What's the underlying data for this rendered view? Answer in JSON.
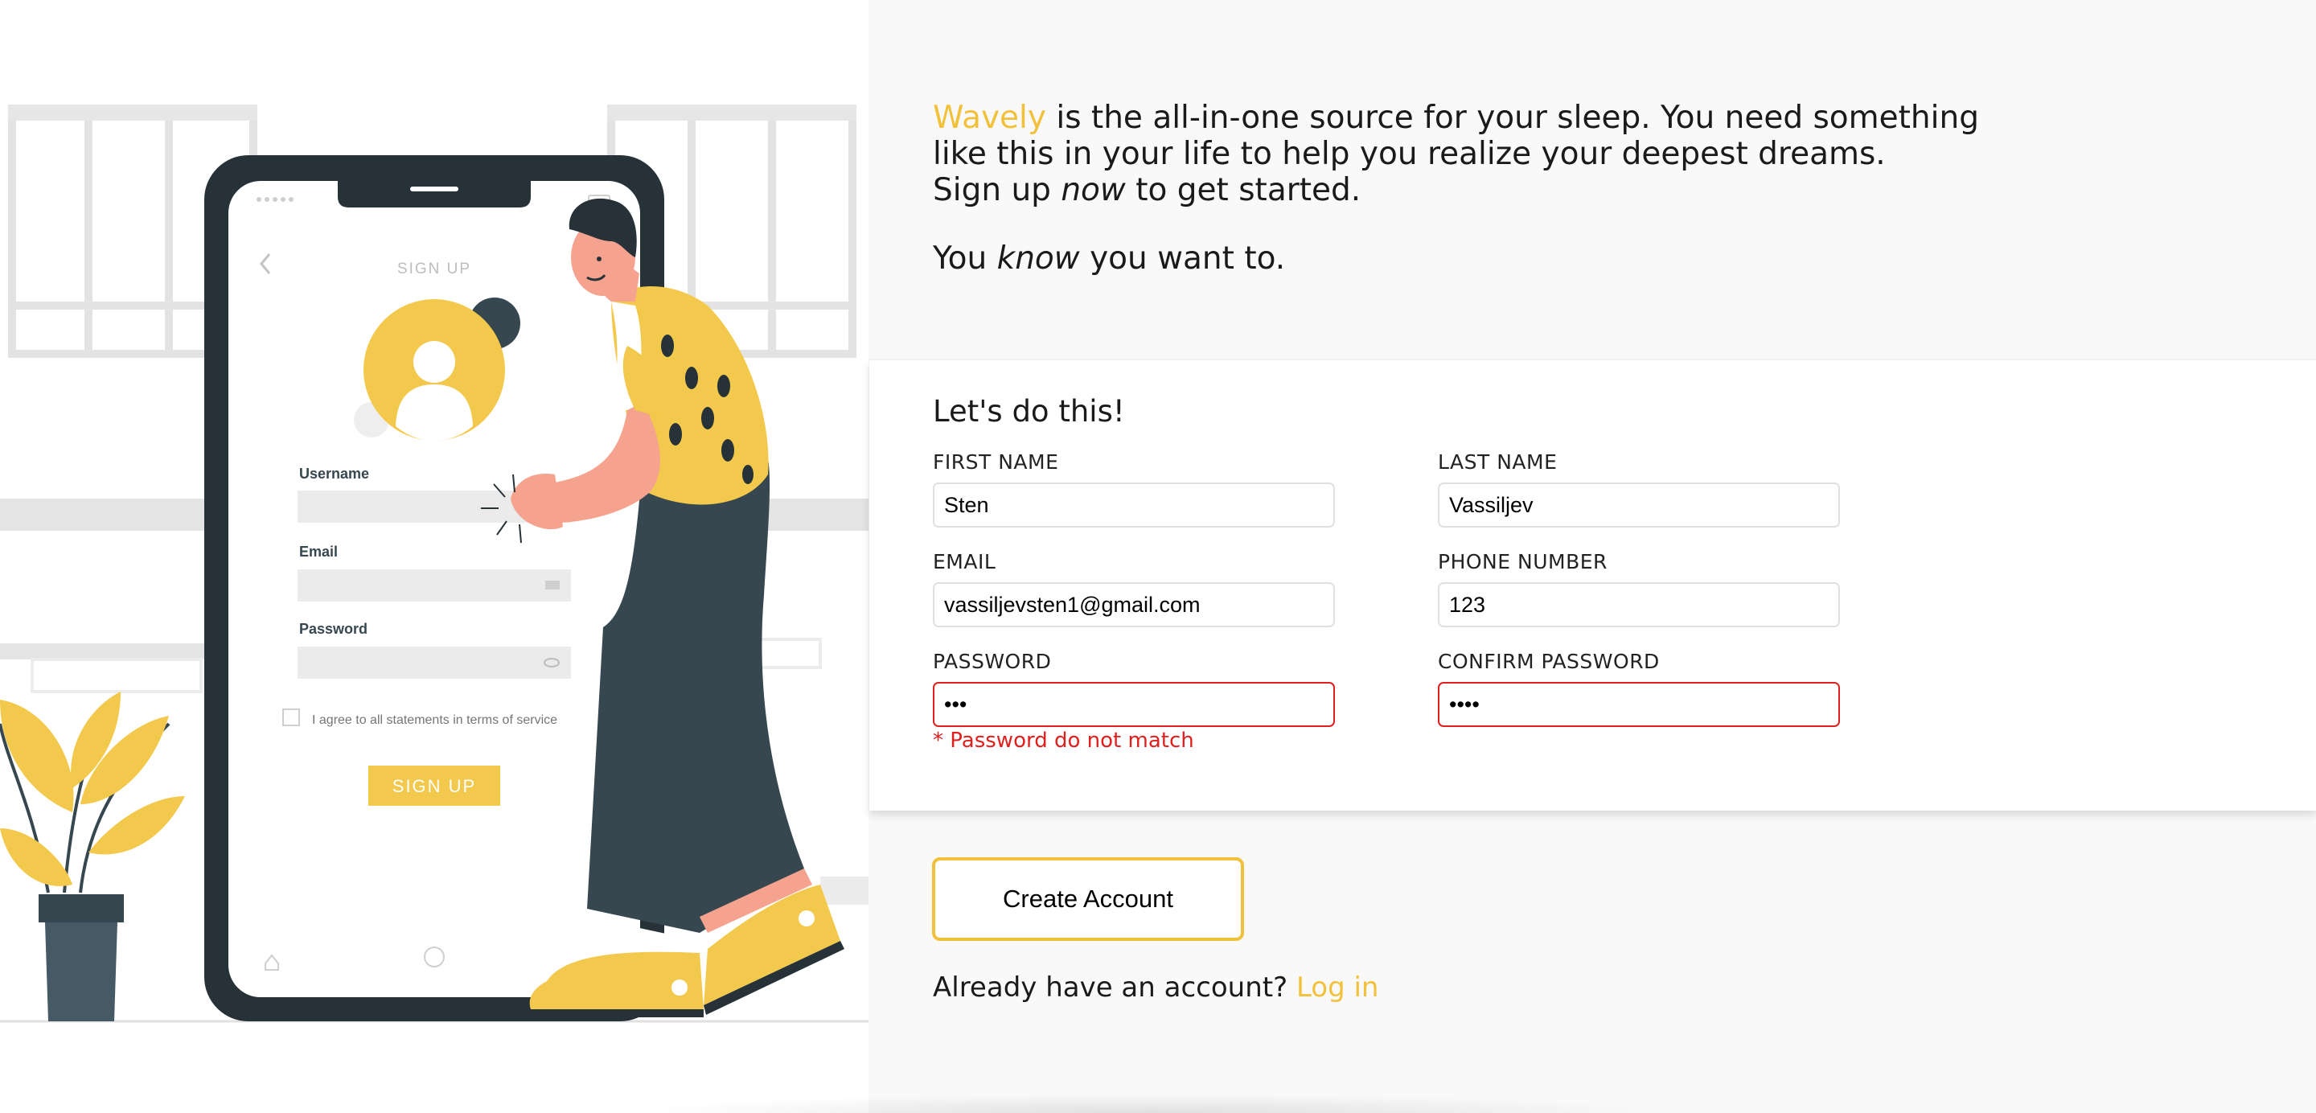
{
  "colors": {
    "accent": "#f2c13b",
    "error": "#e0201e",
    "dark": "#263238"
  },
  "intro": {
    "brand": "Wavely",
    "line1_rest": " is the all-in-one source for your sleep. You need something",
    "line2": "like this in your life to help you realize your deepest dreams.",
    "line3_pre": "Sign up ",
    "line3_em": "now",
    "line3_post": " to get started.",
    "line4_pre": "You ",
    "line4_em": "know",
    "line4_post": " you want to."
  },
  "illustration": {
    "phone_title": "SIGN UP",
    "username_label": "Username",
    "email_label": "Email",
    "password_label": "Password",
    "terms_text": "I agree to all statements in terms of service",
    "signup_button": "SIGN UP"
  },
  "form": {
    "title": "Let's do this!",
    "first_name": {
      "label": "FIRST NAME",
      "value": "Sten"
    },
    "last_name": {
      "label": "LAST NAME",
      "value": "Vassiljev"
    },
    "email": {
      "label": "EMAIL",
      "value": "vassiljevsten1@gmail.com"
    },
    "phone": {
      "label": "PHONE NUMBER",
      "value": "123"
    },
    "password": {
      "label": "PASSWORD",
      "value": "abc"
    },
    "confirm_password": {
      "label": "CONFIRM PASSWORD",
      "value": "abcd"
    },
    "error": "* Password do not match"
  },
  "create_button": "Create Account",
  "login": {
    "prompt": "Already have an account? ",
    "link": "Log in"
  }
}
